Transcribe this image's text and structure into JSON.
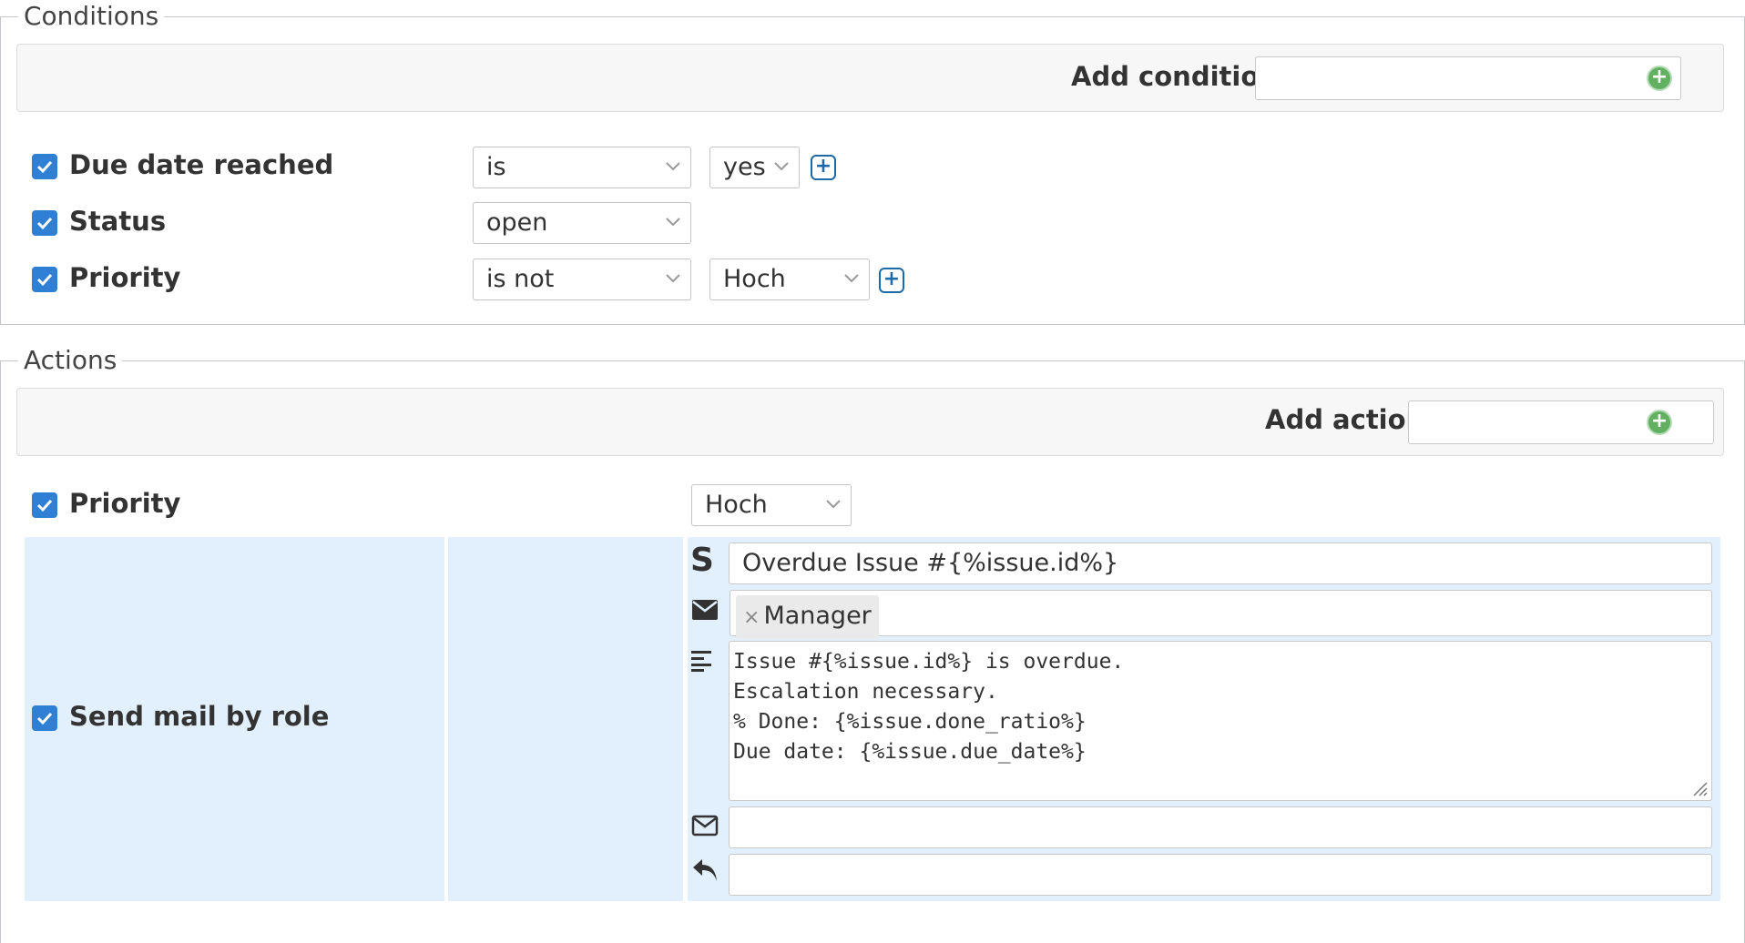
{
  "conditions": {
    "legend": "Conditions",
    "add_label": "Add condition",
    "rows": [
      {
        "label": "Due date reached",
        "operator": "is",
        "value": "yes"
      },
      {
        "label": "Status",
        "operator": "open"
      },
      {
        "label": "Priority",
        "operator": "is not",
        "value": "Hoch"
      }
    ]
  },
  "actions": {
    "legend": "Actions",
    "add_label": "Add action",
    "priority": {
      "label": "Priority",
      "value": "Hoch"
    },
    "send_mail": {
      "label": "Send mail by role",
      "subject": "Overdue Issue #{%issue.id%}",
      "recipient_tag": "Manager",
      "recipient_remove": "×",
      "body": "Issue #{%issue.id%} is overdue.\nEscalation necessary.\n% Done: {%issue.done_ratio%}\nDue date: {%issue.due_date%}",
      "cc": "",
      "reply_to": ""
    }
  },
  "icons": {
    "subject": "S",
    "checkbox_color": "#2f80d4",
    "panel_color": "#e2f0fd"
  }
}
